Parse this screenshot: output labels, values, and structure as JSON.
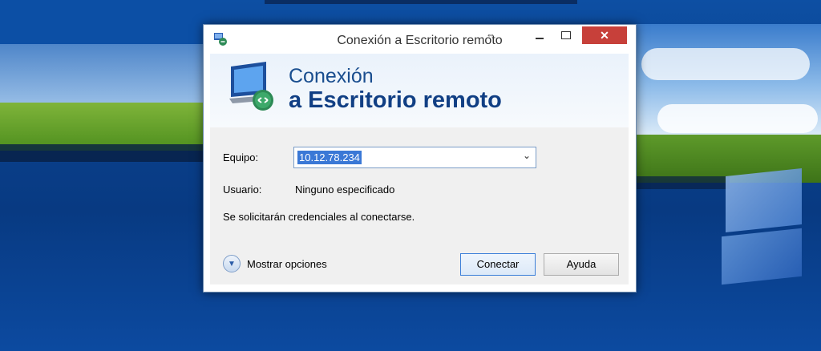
{
  "window": {
    "title": "Conexión a Escritorio remoto",
    "close_label": "✕"
  },
  "banner": {
    "line1": "Conexión",
    "line2": "a Escritorio remoto"
  },
  "form": {
    "equipo_label": "Equipo:",
    "equipo_value": "10.12.78.234",
    "usuario_label": "Usuario:",
    "usuario_value": "Ninguno especificado",
    "info_text": "Se solicitarán credenciales al conectarse."
  },
  "footer": {
    "options_label": "Mostrar opciones",
    "connect_label": "Conectar",
    "help_label": "Ayuda"
  },
  "colors": {
    "accent": "#113f84",
    "close": "#c7403a"
  }
}
